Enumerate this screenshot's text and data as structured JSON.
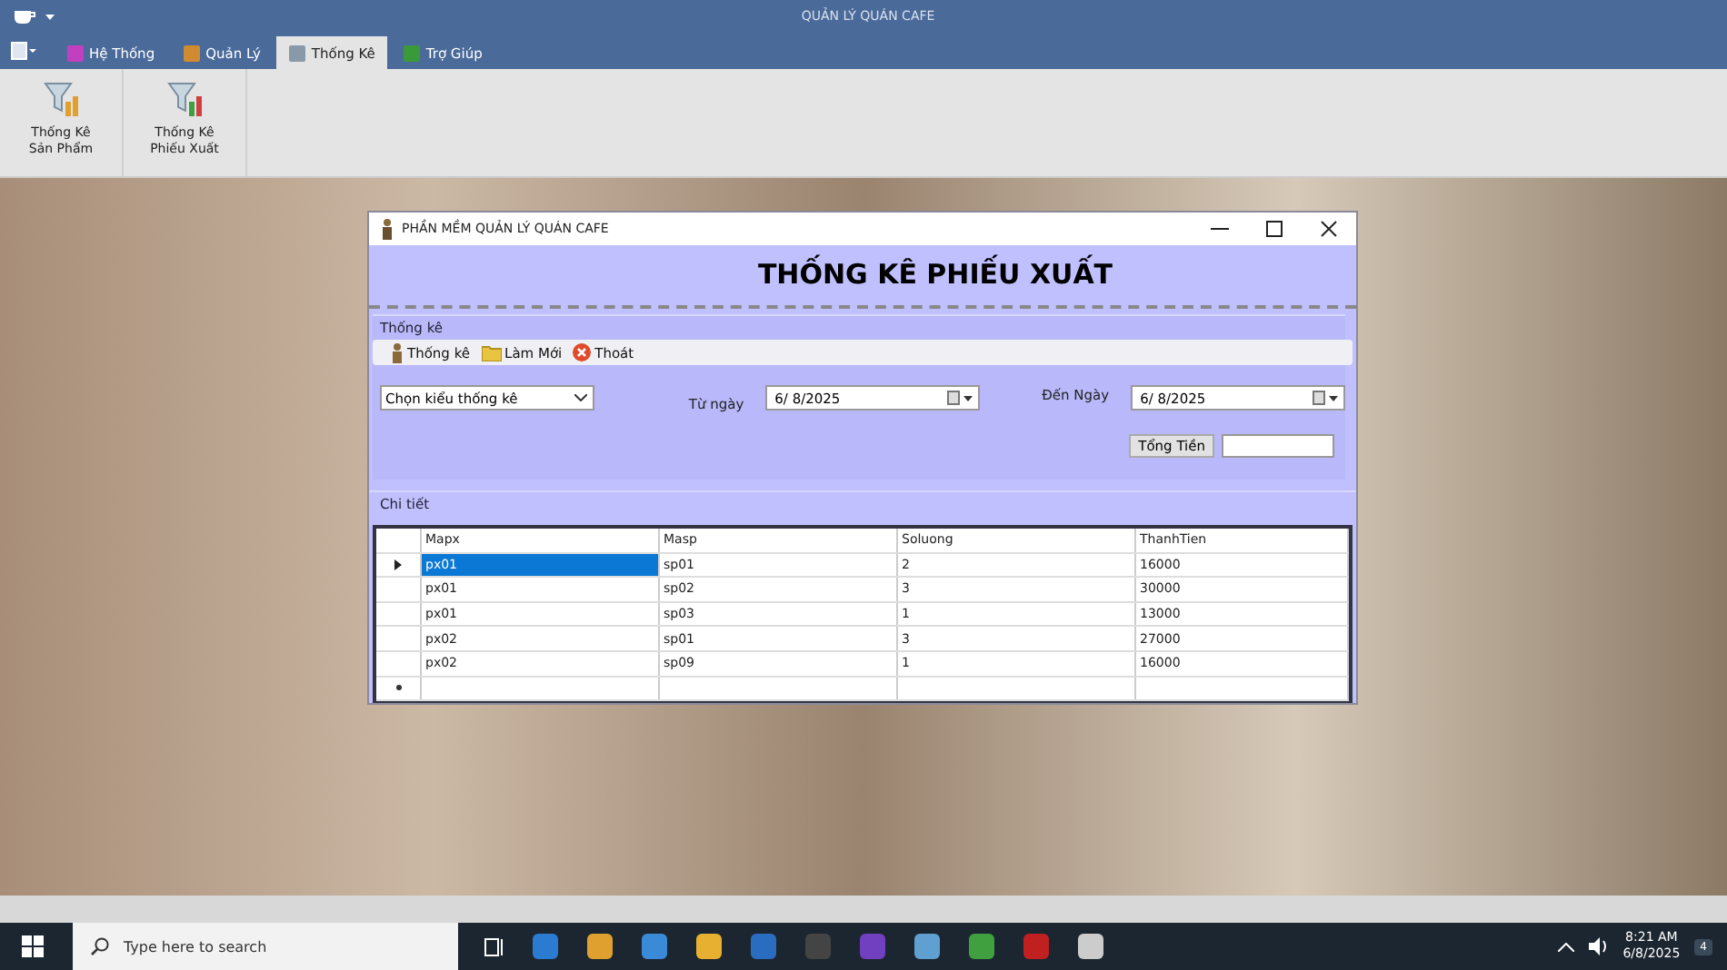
{
  "window": {
    "title": "QUẢN LÝ QUÁN CAFE"
  },
  "ribbon_tabs": [
    {
      "label": "Hệ Thống",
      "selected": false
    },
    {
      "label": "Quản Lý",
      "selected": false
    },
    {
      "label": "Thống Kê",
      "selected": true
    },
    {
      "label": "Trợ Giúp",
      "selected": false
    }
  ],
  "ribbon_buttons": [
    {
      "label": "Thống Kê Sản Phẩm"
    },
    {
      "label": "Thống Kê Phiếu Xuất"
    }
  ],
  "dialog": {
    "title": "PHẦN MỀM QUẢN LÝ QUÁN CAFE",
    "heading": "THỐNG KÊ PHIẾU XUẤT",
    "group_label": "Thống kê",
    "toolbar": [
      {
        "label": "Thống kê",
        "kind": "stats"
      },
      {
        "label": "Làm Mới",
        "kind": "refresh"
      },
      {
        "label": "Thoát",
        "kind": "exit"
      }
    ],
    "report_type": "Chọn kiểu thống kê",
    "from_label": "Từ ngày",
    "from_date": "6/  8/2025",
    "to_label": "Đến Ngày",
    "to_date": "6/  8/2025",
    "total_button": "Tổng Tiền",
    "detail_label": "Chi tiết",
    "table": {
      "columns": [
        "Mapx",
        "Masp",
        "Soluong",
        "ThanhTien"
      ],
      "rows": [
        {
          "cells": [
            "px01",
            "sp01",
            "2",
            "16000"
          ],
          "selected": true
        },
        {
          "cells": [
            "px01",
            "sp02",
            "3",
            "30000"
          ],
          "selected": false
        },
        {
          "cells": [
            "px01",
            "sp03",
            "1",
            "13000"
          ],
          "selected": false
        },
        {
          "cells": [
            "px02",
            "sp01",
            "3",
            "27000"
          ],
          "selected": false
        },
        {
          "cells": [
            "px02",
            "sp09",
            "1",
            "16000"
          ],
          "selected": false
        }
      ]
    }
  },
  "taskbar": {
    "search_placeholder": "Type here to search",
    "time": "8:21 AM",
    "date": "6/8/2025",
    "notifications": "4"
  }
}
